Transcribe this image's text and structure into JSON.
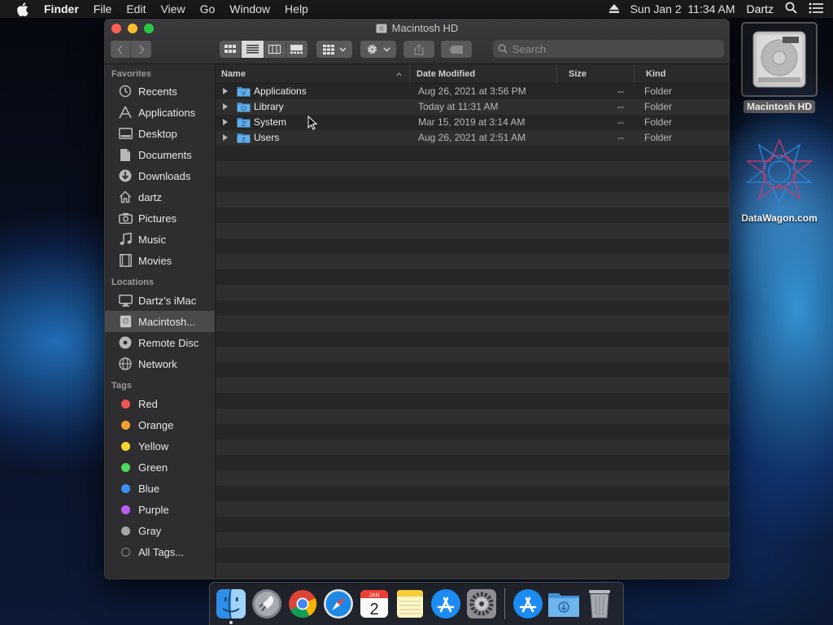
{
  "menubar": {
    "app_name": "Finder",
    "items": [
      "File",
      "Edit",
      "View",
      "Go",
      "Window",
      "Help"
    ],
    "datetime": "Sun Jan 2  11:34 AM",
    "user": "Dartz",
    "icons": [
      "apple-icon",
      "eject-icon",
      "spotlight-icon",
      "notification-center-icon"
    ]
  },
  "window": {
    "title": "Macintosh HD",
    "search_placeholder": "Search",
    "view_mode": "list"
  },
  "sidebar": {
    "favorites_header": "Favorites",
    "favorites": [
      {
        "label": "Recents",
        "icon": "clock-icon"
      },
      {
        "label": "Applications",
        "icon": "applications-icon"
      },
      {
        "label": "Desktop",
        "icon": "desktop-icon"
      },
      {
        "label": "Documents",
        "icon": "document-icon"
      },
      {
        "label": "Downloads",
        "icon": "download-icon"
      },
      {
        "label": "dartz",
        "icon": "home-icon"
      },
      {
        "label": "Pictures",
        "icon": "camera-icon"
      },
      {
        "label": "Music",
        "icon": "music-icon"
      },
      {
        "label": "Movies",
        "icon": "film-icon"
      }
    ],
    "locations_header": "Locations",
    "locations": [
      {
        "label": "Dartz’s iMac",
        "icon": "imac-icon"
      },
      {
        "label": "Macintosh...",
        "icon": "disk-icon",
        "selected": true
      },
      {
        "label": "Remote Disc",
        "icon": "disc-icon"
      },
      {
        "label": "Network",
        "icon": "network-icon"
      }
    ],
    "tags_header": "Tags",
    "tags": [
      {
        "label": "Red",
        "color": "#f05454"
      },
      {
        "label": "Orange",
        "color": "#f5a033"
      },
      {
        "label": "Yellow",
        "color": "#f7d634"
      },
      {
        "label": "Green",
        "color": "#4fd65c"
      },
      {
        "label": "Blue",
        "color": "#3d8ef7"
      },
      {
        "label": "Purple",
        "color": "#bf5cf0"
      },
      {
        "label": "Gray",
        "color": "#a6a6a6"
      },
      {
        "label": "All Tags...",
        "color": "all"
      }
    ]
  },
  "columns": {
    "name": "Name",
    "date": "Date Modified",
    "size": "Size",
    "kind": "Kind"
  },
  "files": [
    {
      "name": "Applications",
      "date": "Aug 26, 2021 at 3:56 PM",
      "size": "--",
      "kind": "Folder"
    },
    {
      "name": "Library",
      "date": "Today at 11:31 AM",
      "size": "--",
      "kind": "Folder"
    },
    {
      "name": "System",
      "date": "Mar 15, 2019 at 3:14 AM",
      "size": "--",
      "kind": "Folder"
    },
    {
      "name": "Users",
      "date": "Aug 26, 2021 at 2:51 AM",
      "size": "--",
      "kind": "Folder"
    }
  ],
  "desktop": {
    "hd_label": "Macintosh HD",
    "datawagon_label": "DataWagon.com"
  },
  "dock": {
    "apps": [
      "finder-icon",
      "launchpad-icon",
      "chrome-icon",
      "safari-icon",
      "calendar-icon",
      "notes-icon",
      "app-store-icon",
      "system-preferences-icon"
    ],
    "calendar": {
      "month": "JAN",
      "day": "2"
    },
    "right": [
      "app-store-downloads-icon",
      "downloads-folder-icon",
      "trash-icon"
    ]
  }
}
